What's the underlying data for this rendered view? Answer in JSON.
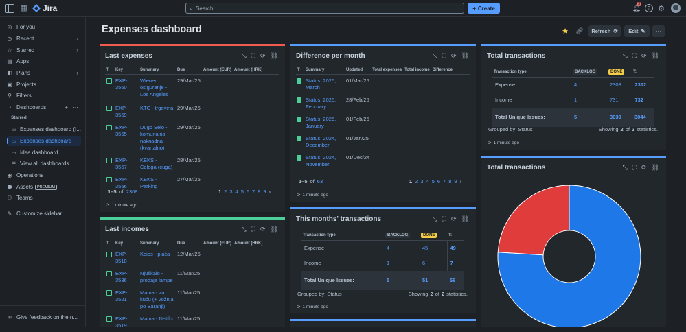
{
  "top": {
    "app_name": "Jira",
    "search_placeholder": "Search",
    "create": "Create",
    "notif_count": "3"
  },
  "sidebar": {
    "items": [
      {
        "label": "For you",
        "icon": "person-circle-icon"
      },
      {
        "label": "Recent",
        "icon": "clock-icon",
        "chev": true
      },
      {
        "label": "Starred",
        "icon": "star-icon",
        "chev": true
      },
      {
        "label": "Apps",
        "icon": "apps-icon"
      },
      {
        "label": "Plans",
        "icon": "plans-icon",
        "chev": true
      },
      {
        "label": "Projects",
        "icon": "projects-icon"
      },
      {
        "label": "Filters",
        "icon": "filter-icon"
      },
      {
        "label": "Dashboards",
        "icon": "dashboard-icon"
      }
    ],
    "starred_heading": "Starred",
    "dash_items": [
      "Expenses dashboard (I...",
      "Expenses dashboard",
      "Idea dashboard",
      "View all dashboards"
    ],
    "bottom_items": [
      {
        "label": "Operations"
      },
      {
        "label": "Assets",
        "badge": "PREMIUM"
      },
      {
        "label": "Teams"
      },
      {
        "label": "Customize sidebar"
      }
    ],
    "feedback": "Give feedback on the n..."
  },
  "header": {
    "title": "Expenses dashboard",
    "refresh": "Refresh",
    "edit": "Edit"
  },
  "last_expenses": {
    "title": "Last expenses",
    "cols": [
      "T",
      "Key",
      "Summary",
      "Due",
      "Amount (EUR)",
      "Amount (HRK)"
    ],
    "rows": [
      {
        "key": "EXP-3560",
        "summary": "Wiener osiguranje - Los Angeles",
        "due": "29/Mar/25"
      },
      {
        "key": "EXP-3559",
        "summary": "KTC - trgovina",
        "due": "29/Mar/25"
      },
      {
        "key": "EXP-3555",
        "summary": "Dugo Selo - komunalna naknadna (kvartalno)",
        "due": "29/Mar/25"
      },
      {
        "key": "EXP-3557",
        "summary": "KEKS - Celega (cuga)",
        "due": "28/Mar/25"
      },
      {
        "key": "EXP-3556",
        "summary": "KEKS - Parking",
        "due": "27/Mar/25"
      }
    ],
    "range": "1–5",
    "of": "of",
    "total": "2308",
    "pages": [
      "1",
      "2",
      "3",
      "4",
      "5",
      "6",
      "7",
      "8",
      "9"
    ],
    "ago": "1 minute ago"
  },
  "diff_month": {
    "title": "Difference per month",
    "cols": [
      "T",
      "Summary",
      "Updated",
      "Total expenses",
      "Total income",
      "Difference"
    ],
    "rows": [
      {
        "summary": "Status: 2025, March",
        "updated": "01/Mar/25"
      },
      {
        "summary": "Status: 2025, February",
        "updated": "28/Feb/25"
      },
      {
        "summary": "Status: 2025, January",
        "updated": "01/Feb/25"
      },
      {
        "summary": "Status: 2024, December",
        "updated": "01/Jan/25"
      },
      {
        "summary": "Status: 2024, November",
        "updated": "01/Dec/24"
      }
    ],
    "range": "1–5",
    "of": "of",
    "total": "63",
    "pages": [
      "1",
      "2",
      "3",
      "4",
      "5",
      "6",
      "7",
      "8",
      "9"
    ],
    "ago": "1 minute ago"
  },
  "total_trans": {
    "title": "Total transactions",
    "cols": [
      "Transaction type",
      "BACKLOG",
      "DONE",
      "T:"
    ],
    "rows": [
      {
        "type": "Expense",
        "backlog": "4",
        "done": "2308",
        "t": "2312"
      },
      {
        "type": "Income",
        "backlog": "1",
        "done": "731",
        "t": "732"
      }
    ],
    "total": {
      "type": "Total Unique Issues:",
      "backlog": "5",
      "done": "3039",
      "t": "3044"
    },
    "grouped": "Grouped by: Status",
    "showing": "Showing",
    "n1": "2",
    "ofw": "of",
    "n2": "2",
    "stat": "statistics.",
    "ago": "1 minute ago"
  },
  "pie": {
    "title": "Total transactions"
  },
  "chart_data": {
    "type": "pie",
    "categories": [
      "Expense",
      "Income"
    ],
    "values": [
      2312,
      732
    ],
    "colors": [
      "#1f78e8",
      "#e03c3c"
    ]
  },
  "last_incomes": {
    "title": "Last incomes",
    "cols": [
      "T",
      "Key",
      "Summary",
      "Due",
      "Amount (EUR)",
      "Amount (HRK)"
    ],
    "rows": [
      {
        "key": "EXP-3518",
        "summary": "Koios - plaća",
        "due": "12/Mar/25"
      },
      {
        "key": "EXP-3536",
        "summary": "Njuškalo - prodaja lampe",
        "due": "11/Mar/25"
      },
      {
        "key": "EXP-3521",
        "summary": "Mama - za kuću (+ vožnja po Baranji)",
        "due": "11/Mar/25"
      },
      {
        "key": "EXP-3519",
        "summary": "Mama - Netflix",
        "due": "11/Mar/25"
      }
    ]
  },
  "month_trans": {
    "title": "This months' transactions",
    "cols": [
      "Transaction type",
      "BACKLOG",
      "DONE",
      "T:"
    ],
    "rows": [
      {
        "type": "Expense",
        "backlog": "4",
        "done": "45",
        "t": "49"
      },
      {
        "type": "Income",
        "backlog": "1",
        "done": "6",
        "t": "7"
      }
    ],
    "total": {
      "type": "Total Unique Issues:",
      "backlog": "5",
      "done": "51",
      "t": "56"
    },
    "grouped": "Grouped by: Status",
    "showing": "Showing",
    "n1": "2",
    "ofw": "of",
    "n2": "2",
    "stat": "statistics.",
    "ago": "1 minute ago"
  }
}
